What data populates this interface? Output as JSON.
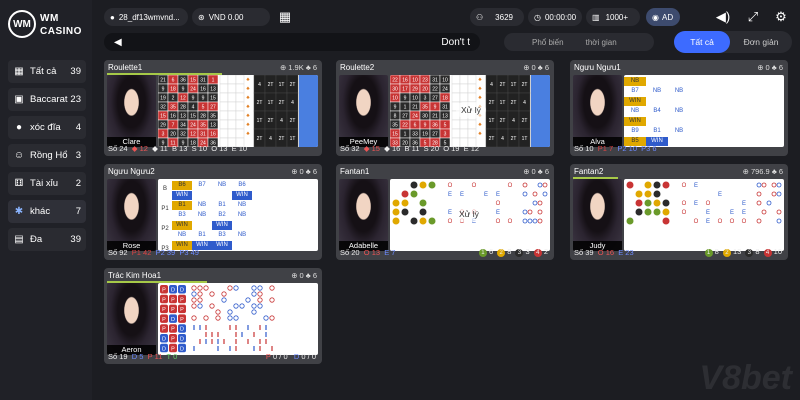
{
  "brand": {
    "line1": "WM",
    "line2": "CASINO",
    "badge": "WM"
  },
  "sidebar": {
    "items": [
      {
        "label": "Tất cả",
        "count": "39",
        "icon": "grid-icon"
      },
      {
        "label": "Baccarat",
        "count": "23",
        "icon": "cards-icon"
      },
      {
        "label": "xóc đĩa",
        "count": "4",
        "icon": "disc-icon"
      },
      {
        "label": "Rồng Hổ",
        "count": "3",
        "icon": "dragon-icon"
      },
      {
        "label": "Tài xỉu",
        "count": "2",
        "icon": "dice-icon"
      },
      {
        "label": "khác",
        "count": "7",
        "icon": "misc-icon"
      },
      {
        "label": "Đa",
        "count": "39",
        "icon": "multi-icon"
      }
    ]
  },
  "header": {
    "user": "28_df13wmvnd...",
    "balance": "VND 0.00",
    "players": "3629",
    "timer": "00:00:00",
    "limit": "1000+",
    "mode": "AD"
  },
  "marquee": {
    "text": "Don't t"
  },
  "filters": {
    "popular": "Phổ biến",
    "time": "thời gian"
  },
  "tabs": {
    "all": "Tất cả",
    "simple": "Đơn giản"
  },
  "tables": [
    {
      "name": "Roulette1",
      "stats": "⊕ 1.9K ♣ 6",
      "dealer": "Clare",
      "footer": [
        "Số 24",
        "◆ 12",
        "◆ 11",
        "B 13",
        "S 10",
        "O 13",
        "E 10"
      ]
    },
    {
      "name": "Roulette2",
      "stats": "⊕ 0 ♣ 6",
      "dealer": "PeeMey",
      "footer": [
        "Số 32",
        "◆ 15",
        "◆ 16",
        "B 11",
        "S 20",
        "O 19",
        "E 12"
      ],
      "badge": "Xử lý"
    },
    {
      "name": "Ngưu Ngưu1",
      "stats": "⊕ 0 ♣ 6",
      "dealer": "Alva",
      "footer": [
        "Số 10",
        "P1 7",
        "P2 10",
        "P3 6"
      ]
    },
    {
      "name": "Ngưu Ngưu2",
      "stats": "⊕ 0 ♣ 6",
      "dealer": "Rose",
      "footer": [
        "Số 92",
        "P1 42",
        "P2 39",
        "P3 49"
      ]
    },
    {
      "name": "Fantan1",
      "stats": "⊕ 0 ♣ 6",
      "dealer": "Adabelle",
      "footer": [
        "Số 20",
        "O 13",
        "E 7"
      ],
      "badge": "Xử lý",
      "right": [
        "1",
        "6",
        "2",
        "8",
        "3",
        "3",
        "4",
        "2"
      ]
    },
    {
      "name": "Fantan2",
      "stats": "⊕ 796.9 ♣ 6",
      "dealer": "Judy",
      "footer": [
        "Số 39",
        "O 16",
        "E 23"
      ],
      "right": [
        "1",
        "8",
        "2",
        "13",
        "3",
        "8",
        "4",
        "10"
      ]
    },
    {
      "name": "Trác Kim Hoa1",
      "stats": "⊕ 0 ♣ 6",
      "dealer": "Aeron",
      "footer": [
        "Số 19",
        "D 5",
        "P 11",
        "T 0"
      ],
      "right": [
        "P",
        "0 / 0",
        "D",
        "0 / 0"
      ]
    }
  ],
  "ngu1": {
    "rows": [
      "P1",
      "P2",
      "P3"
    ],
    "grid": [
      [
        "NB",
        "",
        ""
      ],
      [
        "B7",
        "NB",
        "NB"
      ],
      [
        "WIN",
        "",
        ""
      ],
      [
        "NB",
        "B4",
        "NB"
      ],
      [
        "WIN",
        "",
        ""
      ],
      [
        "B9",
        "B1",
        "NB"
      ],
      [
        "B5",
        "WIN",
        ""
      ]
    ]
  },
  "ngu2": {
    "col": [
      "B",
      "P1",
      "P2",
      "P3"
    ],
    "grid": [
      [
        "B6",
        "B7",
        "NB",
        "B6"
      ],
      [
        "WIN",
        "",
        "",
        "WIN"
      ],
      [
        "B1",
        "NB",
        "B1",
        "NB"
      ],
      [
        "B3",
        "NB",
        "B2",
        "NB"
      ],
      [
        "WIN",
        "",
        "WIN",
        ""
      ],
      [
        "NB",
        "B1",
        "B3",
        "NB"
      ],
      [
        "WIN",
        "WIN",
        "WIN",
        ""
      ]
    ]
  },
  "colors": {
    "accent": "#3d6bff",
    "green": "#a6c948",
    "red": "#d23b3b",
    "black": "#222",
    "blue": "#2f5bcb",
    "gold": "#e0a800"
  },
  "watermark": "V8bet"
}
